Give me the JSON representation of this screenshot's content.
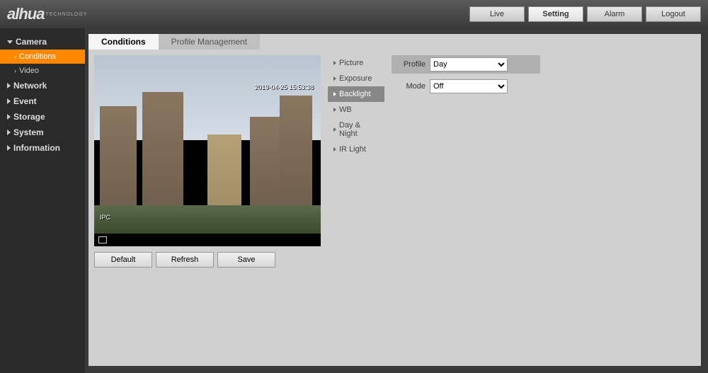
{
  "brand": {
    "name": "alhua",
    "sub": "TECHNOLOGY"
  },
  "nav": {
    "live": "Live",
    "setting": "Setting",
    "alarm": "Alarm",
    "logout": "Logout"
  },
  "sidebar": {
    "camera": "Camera",
    "conditions": "Conditions",
    "video": "Video",
    "network": "Network",
    "event": "Event",
    "storage": "Storage",
    "system": "System",
    "information": "Information"
  },
  "tabs": {
    "conditions": "Conditions",
    "profileMgmt": "Profile Management"
  },
  "video": {
    "label": "IPC",
    "timestamp": "2019-04-25 15:53:38"
  },
  "buttons": {
    "default": "Default",
    "refresh": "Refresh",
    "save": "Save"
  },
  "submenu": {
    "picture": "Picture",
    "exposure": "Exposure",
    "backlight": "Backlight",
    "wb": "WB",
    "dayNight": "Day & Night",
    "irLight": "IR Light"
  },
  "props": {
    "profileLabel": "Profile",
    "profileValue": "Day",
    "modeLabel": "Mode",
    "modeValue": "Off"
  }
}
